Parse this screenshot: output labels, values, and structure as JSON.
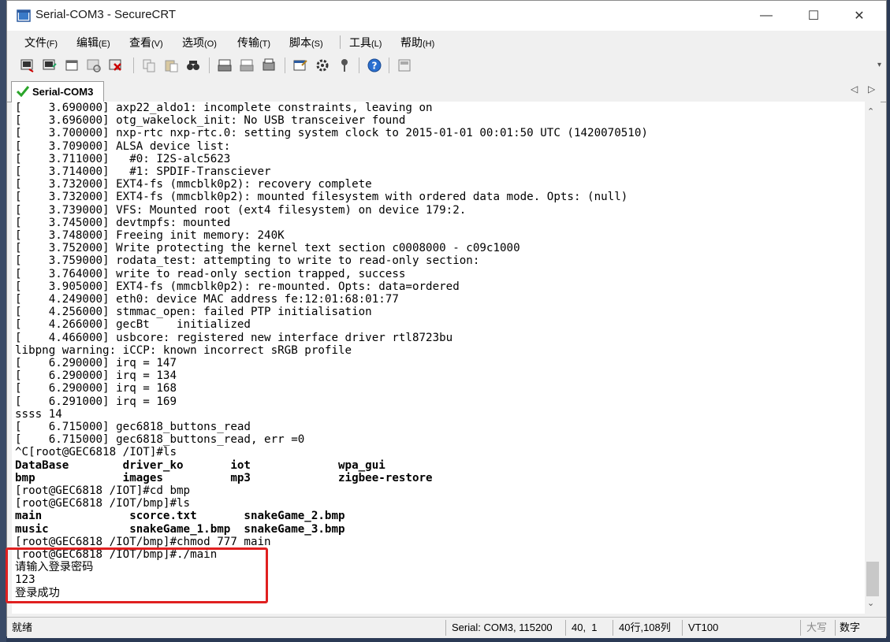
{
  "window": {
    "title": "Serial-COM3 - SecureCRT",
    "minimize": "—",
    "maximize": "☐",
    "close": "✕"
  },
  "menu": [
    {
      "label": "文件",
      "key": "(F)"
    },
    {
      "label": "编辑",
      "key": "(E)"
    },
    {
      "label": "查看",
      "key": "(V)"
    },
    {
      "label": "选项",
      "key": "(O)"
    },
    {
      "label": "传输",
      "key": "(T)"
    },
    {
      "label": "脚本",
      "key": "(S)"
    },
    {
      "label": "工具",
      "key": "(L)"
    },
    {
      "label": "帮助",
      "key": "(H)"
    }
  ],
  "tab": {
    "label": "Serial-COM3",
    "prev": "◁",
    "next": "▷"
  },
  "terminal_lines": [
    "[    3.690000] axp22_aldo1: incomplete constraints, leaving on",
    "[    3.696000] otg_wakelock_init: No USB transceiver found",
    "[    3.700000] nxp-rtc nxp-rtc.0: setting system clock to 2015-01-01 00:01:50 UTC (1420070510)",
    "[    3.709000] ALSA device list:",
    "[    3.711000]   #0: I2S-alc5623",
    "[    3.714000]   #1: SPDIF-Transciever",
    "[    3.732000] EXT4-fs (mmcblk0p2): recovery complete",
    "[    3.732000] EXT4-fs (mmcblk0p2): mounted filesystem with ordered data mode. Opts: (null)",
    "[    3.739000] VFS: Mounted root (ext4 filesystem) on device 179:2.",
    "[    3.745000] devtmpfs: mounted",
    "[    3.748000] Freeing init memory: 240K",
    "[    3.752000] Write protecting the kernel text section c0008000 - c09c1000",
    "[    3.759000] rodata_test: attempting to write to read-only section:",
    "[    3.764000] write to read-only section trapped, success",
    "[    3.905000] EXT4-fs (mmcblk0p2): re-mounted. Opts: data=ordered",
    "[    4.249000] eth0: device MAC address fe:12:01:68:01:77",
    "[    4.256000] stmmac_open: failed PTP initialisation",
    "[    4.266000] gecBt    initialized",
    "[    4.466000] usbcore: registered new interface driver rtl8723bu",
    "libpng warning: iCCP: known incorrect sRGB profile",
    "[    6.290000] irq = 147",
    "[    6.290000] irq = 134",
    "[    6.290000] irq = 168",
    "[    6.291000] irq = 169",
    "ssss 14",
    "[    6.715000] gec6818_buttons_read",
    "[    6.715000] gec6818_buttons_read, err =0",
    "^C[root@GEC6818 /IOT]#ls",
    "DataBase        driver_ko       iot             wpa_gui",
    "bmp             images          mp3             zigbee-restore",
    "[root@GEC6818 /IOT]#cd bmp",
    "[root@GEC6818 /IOT/bmp]#ls",
    "main             scorce.txt       snakeGame_2.bmp",
    "music            snakeGame_1.bmp  snakeGame_3.bmp",
    "[root@GEC6818 /IOT/bmp]#chmod 777 main",
    "[root@GEC6818 /IOT/bmp]#./main",
    "请输入登录密码",
    "123",
    "登录成功"
  ],
  "status": {
    "ready": "就绪",
    "port": "Serial: COM3, 115200",
    "pos": "40,  1",
    "size": "40行,108列",
    "emulation": "VT100",
    "caps": "大写",
    "num": "数字"
  },
  "colors": {
    "highlight": "#e02020",
    "terminal_bg": "#ffffff",
    "tab_check": "#2aa52a"
  }
}
